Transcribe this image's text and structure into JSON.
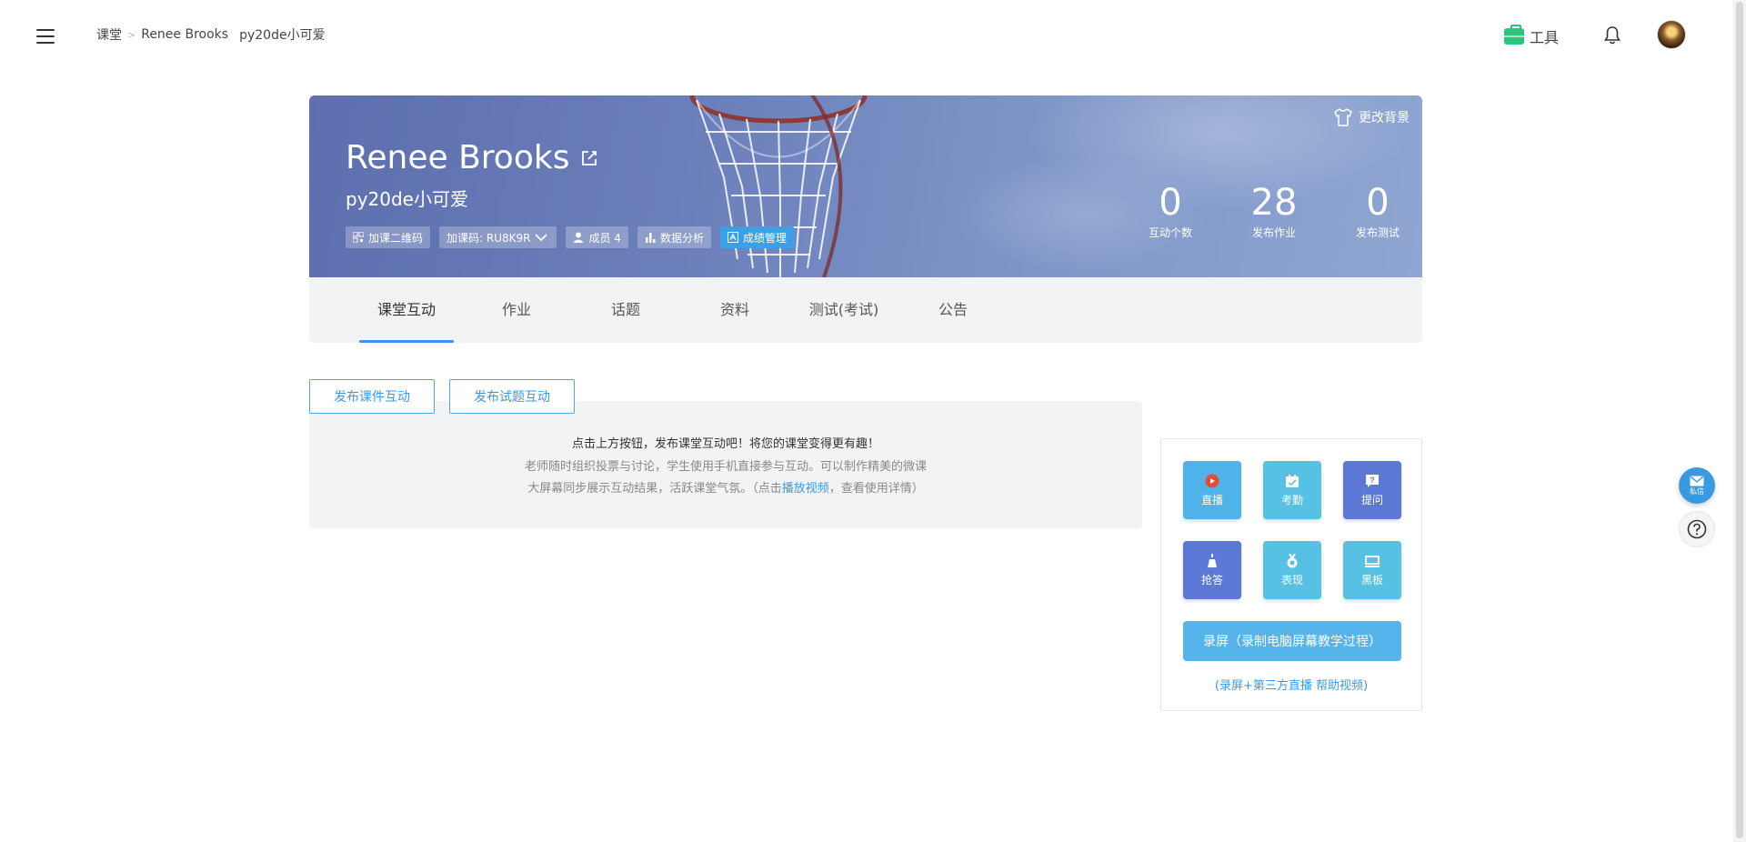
{
  "breadcrumb": {
    "root": "课堂",
    "separator": ">",
    "teacher": "Renee Brooks",
    "class": "py20de小可爱"
  },
  "header": {
    "tools_label": "工具"
  },
  "banner": {
    "change_bg_label": "更改背景",
    "title": "Renee Brooks",
    "subtitle": "py20de小可爱",
    "chips": {
      "qr": "加课二维码",
      "code": "加课码: RU8K9R",
      "members": "成员 4",
      "analytics": "数据分析",
      "grades": "成绩管理"
    },
    "stats": [
      {
        "value": "0",
        "label": "互动个数"
      },
      {
        "value": "28",
        "label": "发布作业"
      },
      {
        "value": "0",
        "label": "发布测试"
      }
    ]
  },
  "tabs": [
    "课堂互动",
    "作业",
    "话题",
    "资料",
    "测试(考试)",
    "公告"
  ],
  "actions": {
    "publish_courseware": "发布课件互动",
    "publish_quiz": "发布试题互动"
  },
  "empty": {
    "line1": "点击上方按钮，发布课堂互动吧！将您的课堂变得更有趣！",
    "line2": "老师随时组织投票与讨论，学生使用手机直接参与互动。可以制作精美的微课",
    "line3_pre": "大屏幕同步展示互动结果，活跃课堂气氛。（点击",
    "line3_link": "播放视频",
    "line3_post": "，查看使用详情）"
  },
  "tools_panel": {
    "tiles": [
      {
        "label": "直播",
        "color": "#4fb3ea"
      },
      {
        "label": "考勤",
        "color": "#56c1e2"
      },
      {
        "label": "提问",
        "color": "#5a78d4"
      },
      {
        "label": "抢答",
        "color": "#5a78d4"
      },
      {
        "label": "表现",
        "color": "#56c1e2"
      },
      {
        "label": "黑板",
        "color": "#56c1e2"
      }
    ],
    "record_label": "录屏（录制电脑屏幕教学过程）",
    "help_label": "(录屏+第三方直播 帮助视频)"
  },
  "floating": {
    "mail_label": "私信"
  }
}
